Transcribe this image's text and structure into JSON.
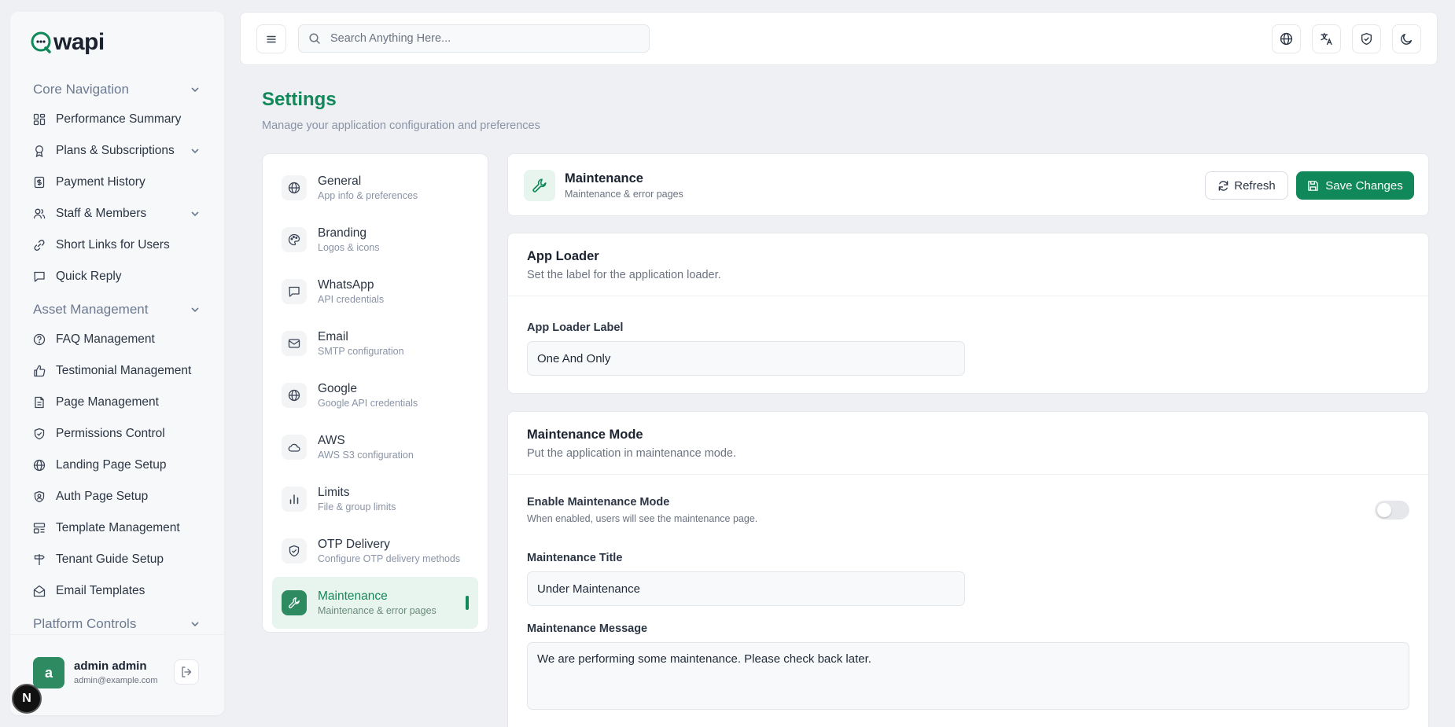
{
  "brand": {
    "name": "wapi",
    "accent": "#11885a"
  },
  "sidebar": {
    "sections": [
      {
        "label": "Core Navigation",
        "items": [
          {
            "label": "Performance Summary",
            "icon": "dashboard-icon",
            "has_sub": false
          },
          {
            "label": "Plans & Subscriptions",
            "icon": "award-icon",
            "has_sub": true
          },
          {
            "label": "Payment History",
            "icon": "receipt-icon",
            "has_sub": false
          },
          {
            "label": "Staff & Members",
            "icon": "users-icon",
            "has_sub": true
          },
          {
            "label": "Short Links for Users",
            "icon": "link-icon",
            "has_sub": false
          },
          {
            "label": "Quick Reply",
            "icon": "message-icon",
            "has_sub": false
          }
        ]
      },
      {
        "label": "Asset Management",
        "items": [
          {
            "label": "FAQ Management",
            "icon": "help-icon"
          },
          {
            "label": "Testimonial Management",
            "icon": "thumbs-up-icon"
          },
          {
            "label": "Page Management",
            "icon": "file-icon"
          },
          {
            "label": "Permissions Control",
            "icon": "shield-icon"
          },
          {
            "label": "Landing Page Setup",
            "icon": "globe-icon"
          },
          {
            "label": "Auth Page Setup",
            "icon": "shield-user-icon"
          },
          {
            "label": "Template Management",
            "icon": "layout-icon"
          },
          {
            "label": "Tenant Guide Setup",
            "icon": "signpost-icon"
          },
          {
            "label": "Email Templates",
            "icon": "mail-open-icon"
          }
        ]
      },
      {
        "label": "Platform Controls",
        "items": []
      }
    ],
    "user": {
      "initial": "a",
      "name": "admin admin",
      "email": "admin@example.com"
    }
  },
  "topbar": {
    "search_placeholder": "Search Anything Here..."
  },
  "page": {
    "title": "Settings",
    "subtitle": "Manage your application configuration and preferences"
  },
  "settings_menu": [
    {
      "title": "General",
      "subtitle": "App info & preferences",
      "icon": "globe-icon"
    },
    {
      "title": "Branding",
      "subtitle": "Logos & icons",
      "icon": "palette-icon"
    },
    {
      "title": "WhatsApp",
      "subtitle": "API credentials",
      "icon": "message-icon"
    },
    {
      "title": "Email",
      "subtitle": "SMTP configuration",
      "icon": "mail-icon"
    },
    {
      "title": "Google",
      "subtitle": "Google API credentials",
      "icon": "globe-icon"
    },
    {
      "title": "AWS",
      "subtitle": "AWS S3 configuration",
      "icon": "cloud-icon"
    },
    {
      "title": "Limits",
      "subtitle": "File & group limits",
      "icon": "bar-chart-icon"
    },
    {
      "title": "OTP Delivery",
      "subtitle": "Configure OTP delivery methods",
      "icon": "shield-icon"
    },
    {
      "title": "Maintenance",
      "subtitle": "Maintenance & error pages",
      "icon": "wrench-icon",
      "active": true
    }
  ],
  "maintenance_header": {
    "title": "Maintenance",
    "subtitle": "Maintenance & error pages",
    "refresh_label": "Refresh",
    "save_label": "Save Changes"
  },
  "app_loader": {
    "title": "App Loader",
    "subtitle": "Set the label for the application loader.",
    "label_field": "App Loader Label",
    "label_value": "One And Only"
  },
  "maintenance_mode": {
    "title": "Maintenance Mode",
    "subtitle": "Put the application in maintenance mode.",
    "toggle_label": "Enable Maintenance Mode",
    "toggle_desc": "When enabled, users will see the maintenance page.",
    "toggle_on": false,
    "title_label": "Maintenance Title",
    "title_value": "Under Maintenance",
    "message_label": "Maintenance Message",
    "message_value": "We are performing some maintenance. Please check back later."
  }
}
